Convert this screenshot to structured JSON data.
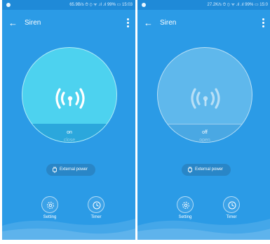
{
  "screens": [
    {
      "status_text": "65.9B/s ⏱ ⊙ ᯤ .ıl .ıl 99% ▭ 15:03",
      "title": "Siren",
      "state_label": "on",
      "state_action": "close",
      "external_power_label": "External power",
      "setting_label": "Setting",
      "timer_label": "Timer"
    },
    {
      "status_text": "27.2K/s ⏱ ⊙ ᯤ .ıl .ıl 99% ▭ 15:0",
      "title": "Siren",
      "state_label": "off",
      "state_action": "open",
      "external_power_label": "External power",
      "setting_label": "Setting",
      "timer_label": "Timer"
    }
  ],
  "icons": {
    "back": "arrow-left-icon",
    "menu": "more-vertical-icon",
    "siren": "siren-waves-icon",
    "plug": "plug-icon",
    "setting": "gear-icon",
    "timer": "clock-icon"
  },
  "colors": {
    "background": "#2b9be6",
    "status_bar": "#1f8ad8",
    "circle_on": "#4dd2ef",
    "circle_off": "#5fb8ec",
    "pill": "#2986c7"
  }
}
